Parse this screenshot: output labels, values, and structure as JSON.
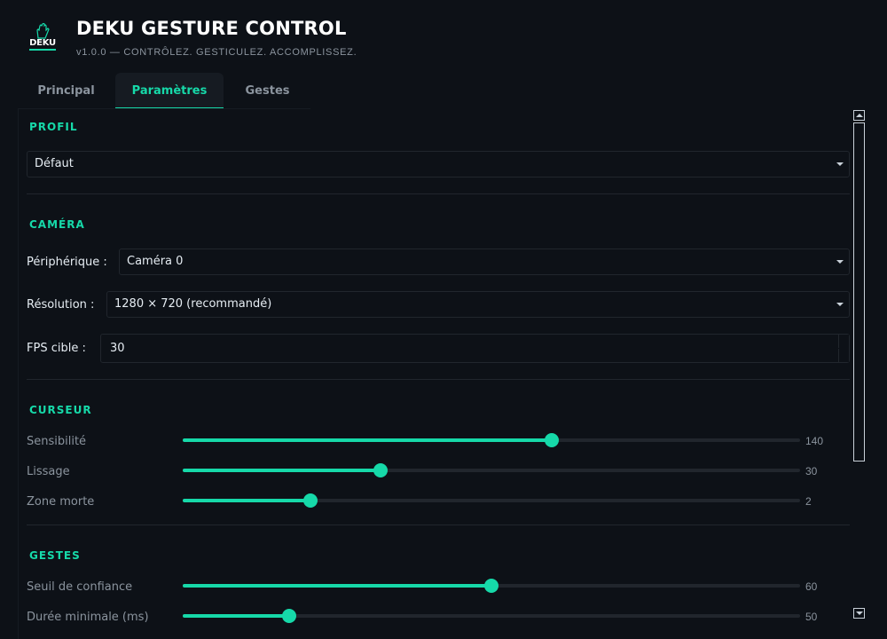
{
  "header": {
    "logo_text": "DEKU",
    "title": "DEKU GESTURE CONTROL",
    "subtitle": "v1.0.0 — CONTRÔLEZ. GESTICULEZ. ACCOMPLISSEZ."
  },
  "tabs": [
    {
      "label": "Principal",
      "active": false
    },
    {
      "label": "Paramètres",
      "active": true
    },
    {
      "label": "Gestes",
      "active": false
    }
  ],
  "profil": {
    "title": "PROFIL",
    "selected": "Défaut"
  },
  "camera": {
    "title": "CAMÉRA",
    "device_label": "Périphérique :",
    "device_value": "Caméra 0",
    "resolution_label": "Résolution :",
    "resolution_value": "1280 × 720 (recommandé)",
    "fps_label": "FPS cible :",
    "fps_value": "30"
  },
  "curseur": {
    "title": "CURSEUR",
    "sliders": [
      {
        "label": "Sensibilité",
        "value": "140",
        "fraction": 0.598
      },
      {
        "label": "Lissage",
        "value": "30",
        "fraction": 0.32
      },
      {
        "label": "Zone morte",
        "value": "2",
        "fraction": 0.207
      }
    ]
  },
  "gestes": {
    "title": "GESTES",
    "sliders": [
      {
        "label": "Seuil de confiance",
        "value": "60",
        "fraction": 0.5
      },
      {
        "label": "Durée minimale (ms)",
        "value": "50",
        "fraction": 0.173
      }
    ]
  },
  "colors": {
    "accent": "#16d9a9",
    "background": "#0d1117",
    "muted_text": "#8b949e"
  }
}
